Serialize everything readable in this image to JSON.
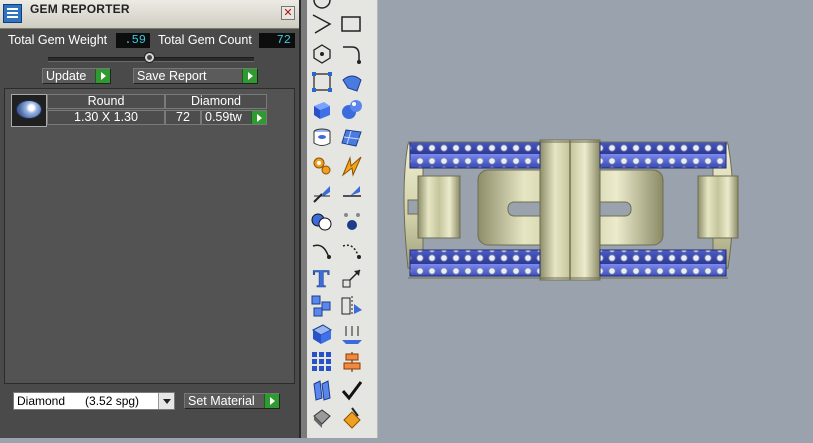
{
  "panel": {
    "title": "GEM REPORTER",
    "total_weight_label": "Total Gem Weight",
    "total_weight_value": ".59",
    "total_count_label": "Total Gem Count",
    "total_count_value": "72",
    "update_label": "Update",
    "save_report_label": "Save Report",
    "table": {
      "headers": [
        "Round",
        "Diamond"
      ],
      "rows": [
        {
          "size": "1.30 X 1.30",
          "count": "72",
          "weight": "0.59tw"
        }
      ]
    },
    "material_selected": "Diamond      (3.52 spg)",
    "set_material_label": "Set Material"
  },
  "palette": {
    "tools": [
      "circle-tool-icon",
      "rectangle-tool-icon",
      "polyline-tool-icon",
      "rect-frame-icon",
      "polygon-tool-icon",
      "fillet-curve-icon",
      "point-grid-icon",
      "bend-surface-icon",
      "box-solid-icon",
      "sphere-solid-icon",
      "cylinder-solid-icon",
      "surface-patch-icon",
      "gear-tool-icon",
      "flash-tool-icon",
      "knife-tool-icon",
      "cut-tool-icon",
      "boolean-union-icon",
      "vertex-points-icon",
      "curve-arc-icon",
      "curve-dashed-icon",
      "text-tool-icon",
      "scale-arrows-icon",
      "array-grid-icon",
      "mirror-tool-icon",
      "solid-shell-icon",
      "extrude-arrows-icon",
      "dot-grid-icon",
      "align-tool-icon",
      "flow-curve-icon",
      "check-icon",
      "shape-render-icon",
      "material-paint-icon"
    ]
  },
  "colors": {
    "panel_bg": "#4a4a4a",
    "value_text": "#35c9e0",
    "go_button": "#2f9a2f",
    "gem_channel_blue": "#4f5fc6",
    "metal_cream": "#d8d8b0",
    "viewport_bg": "#9aa3ad"
  }
}
